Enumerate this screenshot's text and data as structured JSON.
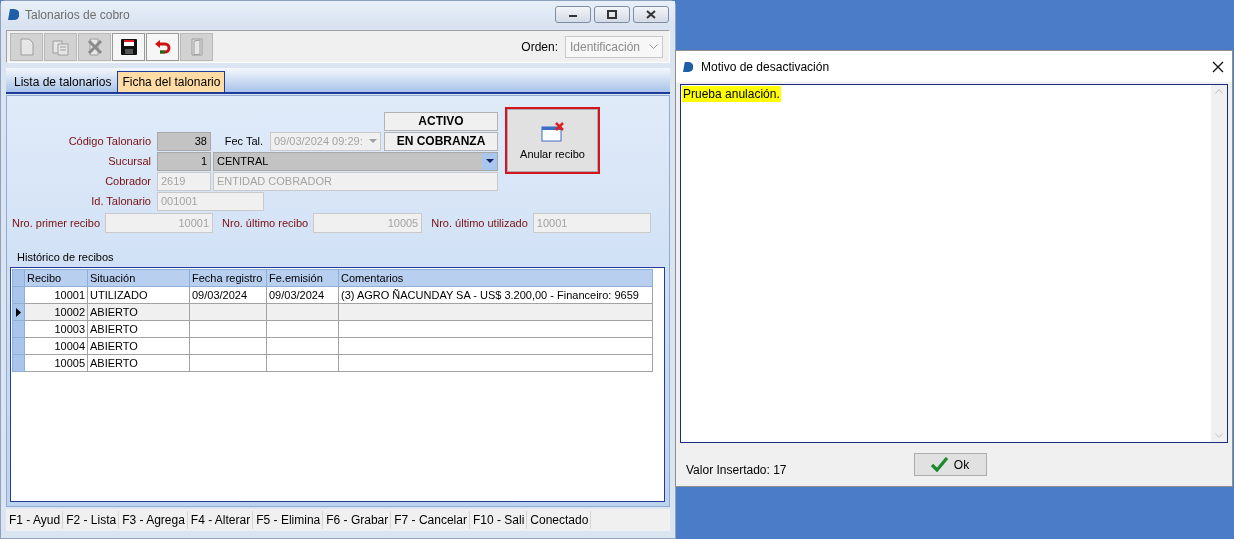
{
  "window": {
    "title": "Talonarios de cobro"
  },
  "toolbar": {
    "buttons": [
      {
        "kind": "new",
        "disabled": true
      },
      {
        "kind": "copy",
        "disabled": true
      },
      {
        "kind": "delete",
        "disabled": true
      },
      {
        "kind": "save",
        "disabled": false
      },
      {
        "kind": "undo",
        "disabled": false
      },
      {
        "kind": "exit",
        "disabled": true
      }
    ],
    "order": {
      "label": "Orden:",
      "value": "Identificación",
      "disabled": true
    }
  },
  "tabs": [
    {
      "label": "Lista de talonarios",
      "selected": false
    },
    {
      "label": "Ficha del talonario",
      "selected": true
    }
  ],
  "status_badges": [
    "ACTIVO",
    "EN COBRANZA"
  ],
  "void_button": {
    "label": "Anular recibo",
    "focused": true
  },
  "record": {
    "code": {
      "label": "Código Talonario",
      "value": "38",
      "disabled": false
    },
    "date": {
      "label": "Fec Tal.",
      "value": "09/03/2024 09:29:",
      "disabled": true
    },
    "branch": {
      "label": "Sucursal",
      "code": "1",
      "name": "CENTRAL",
      "disabled": false
    },
    "collector": {
      "label": "Cobrador",
      "code": "2619",
      "name": "ENTIDAD COBRADOR",
      "disabled": true
    },
    "book_id": {
      "label": "Id. Talonario",
      "value": "001001",
      "disabled": true
    },
    "first": {
      "label": "Nro. primer recibo",
      "value": "10001",
      "disabled": true
    },
    "last": {
      "label": "Nro. último recibo",
      "value": "10005",
      "disabled": true
    },
    "used": {
      "label": "Nro. último utilizado",
      "value": "10001",
      "disabled": true
    }
  },
  "history": {
    "title": "Histórico de recibos",
    "columns": [
      "Recibo",
      "Situación",
      "Fecha registro",
      "Fe.emisión",
      "Comentarios"
    ],
    "rows": [
      {
        "cells": [
          "10001",
          "UTILIZADO",
          "09/03/2024",
          "09/03/2024",
          "(3) AGRO ÑACUNDAY SA - US$ 3.200,00 - Financeiro: 9659"
        ],
        "current": false
      },
      {
        "cells": [
          "10002",
          "ABIERTO",
          "",
          "",
          ""
        ],
        "current": true
      },
      {
        "cells": [
          "10003",
          "ABIERTO",
          "",
          "",
          ""
        ],
        "current": false
      },
      {
        "cells": [
          "10004",
          "ABIERTO",
          "",
          "",
          ""
        ],
        "current": false
      },
      {
        "cells": [
          "10005",
          "ABIERTO",
          "",
          "",
          ""
        ],
        "current": false
      }
    ]
  },
  "status_bar": [
    "F1 - Ayud",
    "F2 - Lista",
    "F3 - Agrega",
    "F4 - Alterar",
    "F5 - Elimina",
    "F6 - Grabar",
    "F7 - Cancelar",
    "F10 - Sali",
    "Conectado"
  ],
  "dialog": {
    "title": "Motivo de desactivación",
    "text": "Prueba anulación.",
    "highlighted": true,
    "info": "Valor Insertado: 17",
    "ok": "Ok"
  }
}
